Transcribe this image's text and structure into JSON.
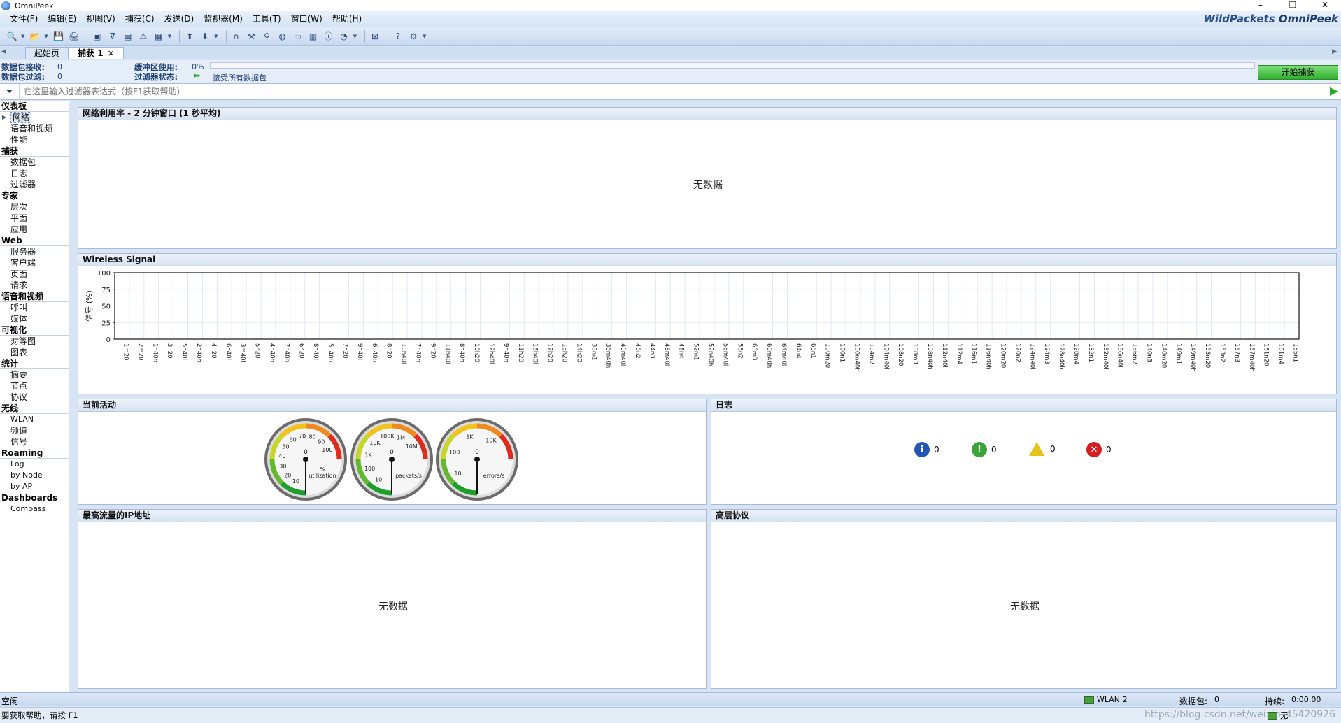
{
  "window": {
    "title": "OmniPeek",
    "controls": [
      "–",
      "❐",
      "✕"
    ]
  },
  "brand": {
    "left": "WildPackets",
    "right": "OmniPeek"
  },
  "menu": [
    "文件(F)",
    "编辑(E)",
    "视图(V)",
    "捕获(C)",
    "发送(D)",
    "监视器(M)",
    "工具(T)",
    "窗口(W)",
    "帮助(H)"
  ],
  "toolbar": {
    "icons": [
      "search-icon",
      "open-icon",
      "save-icon",
      "print-icon",
      "capture-icon",
      "filter-icon",
      "report-icon",
      "alert-icon",
      "stats-icon",
      "trigger-icon",
      "send-icon",
      "network-icon",
      "tools-icon",
      "map-icon",
      "globe-icon",
      "graph-icon",
      "bar-icon",
      "info-icon",
      "chart-icon",
      "close-icon",
      "help-icon",
      "settings-icon"
    ]
  },
  "tabs": {
    "start_page": "起始页",
    "capture": "捕获 1",
    "close": "×"
  },
  "stats": {
    "packets_received_label": "数据包接收:",
    "packets_received": "0",
    "packets_filtered_label": "数据包过滤:",
    "packets_filtered": "0",
    "buffer_label": "缓冲区使用:",
    "buffer_value": "0%",
    "filter_state_label": "过滤器状态:",
    "filter_state": "接受所有数据包",
    "start_button": "开始捕获"
  },
  "filter": {
    "placeholder": "在这里输入过滤器表达式（按F1获取帮助）"
  },
  "sidebar": {
    "sections": [
      {
        "title": "仪表板",
        "items": [
          "网络",
          "语音和视频",
          "性能"
        ]
      },
      {
        "title": "捕获",
        "items": [
          "数据包",
          "日志",
          "过滤器"
        ]
      },
      {
        "title": "专家",
        "items": [
          "层次",
          "平面",
          "应用"
        ]
      },
      {
        "title": "Web",
        "items": [
          "服务器",
          "客户端",
          "页面",
          "请求"
        ]
      },
      {
        "title": "语音和视频",
        "items": [
          "呼叫",
          "媒体"
        ]
      },
      {
        "title": "可视化",
        "items": [
          "对等图",
          "图表"
        ]
      },
      {
        "title": "统计",
        "items": [
          "摘要",
          "节点",
          "协议"
        ]
      },
      {
        "title": "无线",
        "items": [
          "WLAN",
          "频道",
          "信号"
        ]
      },
      {
        "title": "Roaming",
        "items": [
          "Log",
          "by Node",
          "by AP"
        ]
      },
      {
        "title": "Dashboards",
        "items": [
          "Compass"
        ]
      }
    ],
    "selected": "网络"
  },
  "panels": {
    "network_util": {
      "title": "网络利用率 - 2 分钟窗口 (1 秒平均)",
      "nodata": "无数据"
    },
    "wireless": {
      "title": "Wireless Signal"
    },
    "activity": {
      "title": "当前活动"
    },
    "log": {
      "title": "日志"
    },
    "top_ip": {
      "title": "最高流量的IP地址",
      "nodata": "无数据"
    },
    "top_proto": {
      "title": "高层协议",
      "nodata": "无数据"
    }
  },
  "chart_data": {
    "type": "line",
    "title": "Wireless Signal",
    "ylabel": "信号 (%)",
    "ylim": [
      0,
      100
    ],
    "yticks": [
      0,
      25,
      50,
      75,
      100
    ],
    "grid": true,
    "x": [
      "1m20",
      "2m20",
      "1h40h",
      "3h20",
      "5h40l",
      "2h40h",
      "4h20",
      "6h40l",
      "3m40l",
      "5h20",
      "4h40h",
      "7h40h",
      "6h20",
      "8h40l",
      "5h40h",
      "7h20",
      "9h40l",
      "6h40h",
      "8h20",
      "10h40l",
      "7h40h",
      "9h20",
      "11h40l",
      "8h40h",
      "10h20",
      "12h40l",
      "9h40h",
      "11h20",
      "13h40l",
      "12h20",
      "13h20",
      "14h20",
      "36m1",
      "36m40h",
      "40m40l",
      "40n2",
      "44n3",
      "48m40l",
      "48n4",
      "52m1",
      "52n40h",
      "56m40l",
      "56n2",
      "60m3",
      "60m40h",
      "64m40l",
      "64n4",
      "68n1",
      "100m20",
      "100n1",
      "100m40h",
      "104m2",
      "104m40l",
      "108n20",
      "108m3",
      "108n40h",
      "112n40l",
      "112m4",
      "116m1",
      "116n40h",
      "120m20",
      "120n2",
      "124m40l",
      "124m3",
      "128n40h",
      "128m4",
      "132n1",
      "132m40h",
      "136n40l",
      "136m2",
      "140n3",
      "140m20",
      "149m1",
      "149m40h",
      "153m20",
      "153n2",
      "157n3",
      "157m40h",
      "161n20",
      "161m4",
      "165n1"
    ],
    "series": []
  },
  "gauges": [
    {
      "unit": "%",
      "label": "utilization",
      "value": 0,
      "ticks": [
        "10",
        "20",
        "30",
        "40",
        "50",
        "60",
        "70",
        "80",
        "90",
        "100"
      ]
    },
    {
      "unit": "",
      "label": "packets/s",
      "value": 0,
      "ticks": [
        "10",
        "100",
        "1K",
        "10K",
        "100K",
        "1M",
        "10M"
      ]
    },
    {
      "unit": "",
      "label": "errors/s",
      "value": 0,
      "ticks": [
        "10",
        "100",
        "1K",
        "10K"
      ]
    }
  ],
  "log_counts": [
    {
      "kind": "info",
      "count": "0",
      "color": "#2155b8"
    },
    {
      "kind": "notice",
      "count": "0",
      "color": "#3aa33a"
    },
    {
      "kind": "warning",
      "count": "0",
      "color": "#e8c21c"
    },
    {
      "kind": "error",
      "count": "0",
      "color": "#d42020"
    }
  ],
  "status": {
    "state": "空闲",
    "adapter": "WLAN 2",
    "packets_label": "数据包:",
    "packets": "0",
    "duration_label": "持续:",
    "duration": "0:00:00",
    "help": "要获取帮助，请按 F1",
    "mode": "无",
    "watermark": "https://blog.csdn.net/weixin_45420926"
  }
}
